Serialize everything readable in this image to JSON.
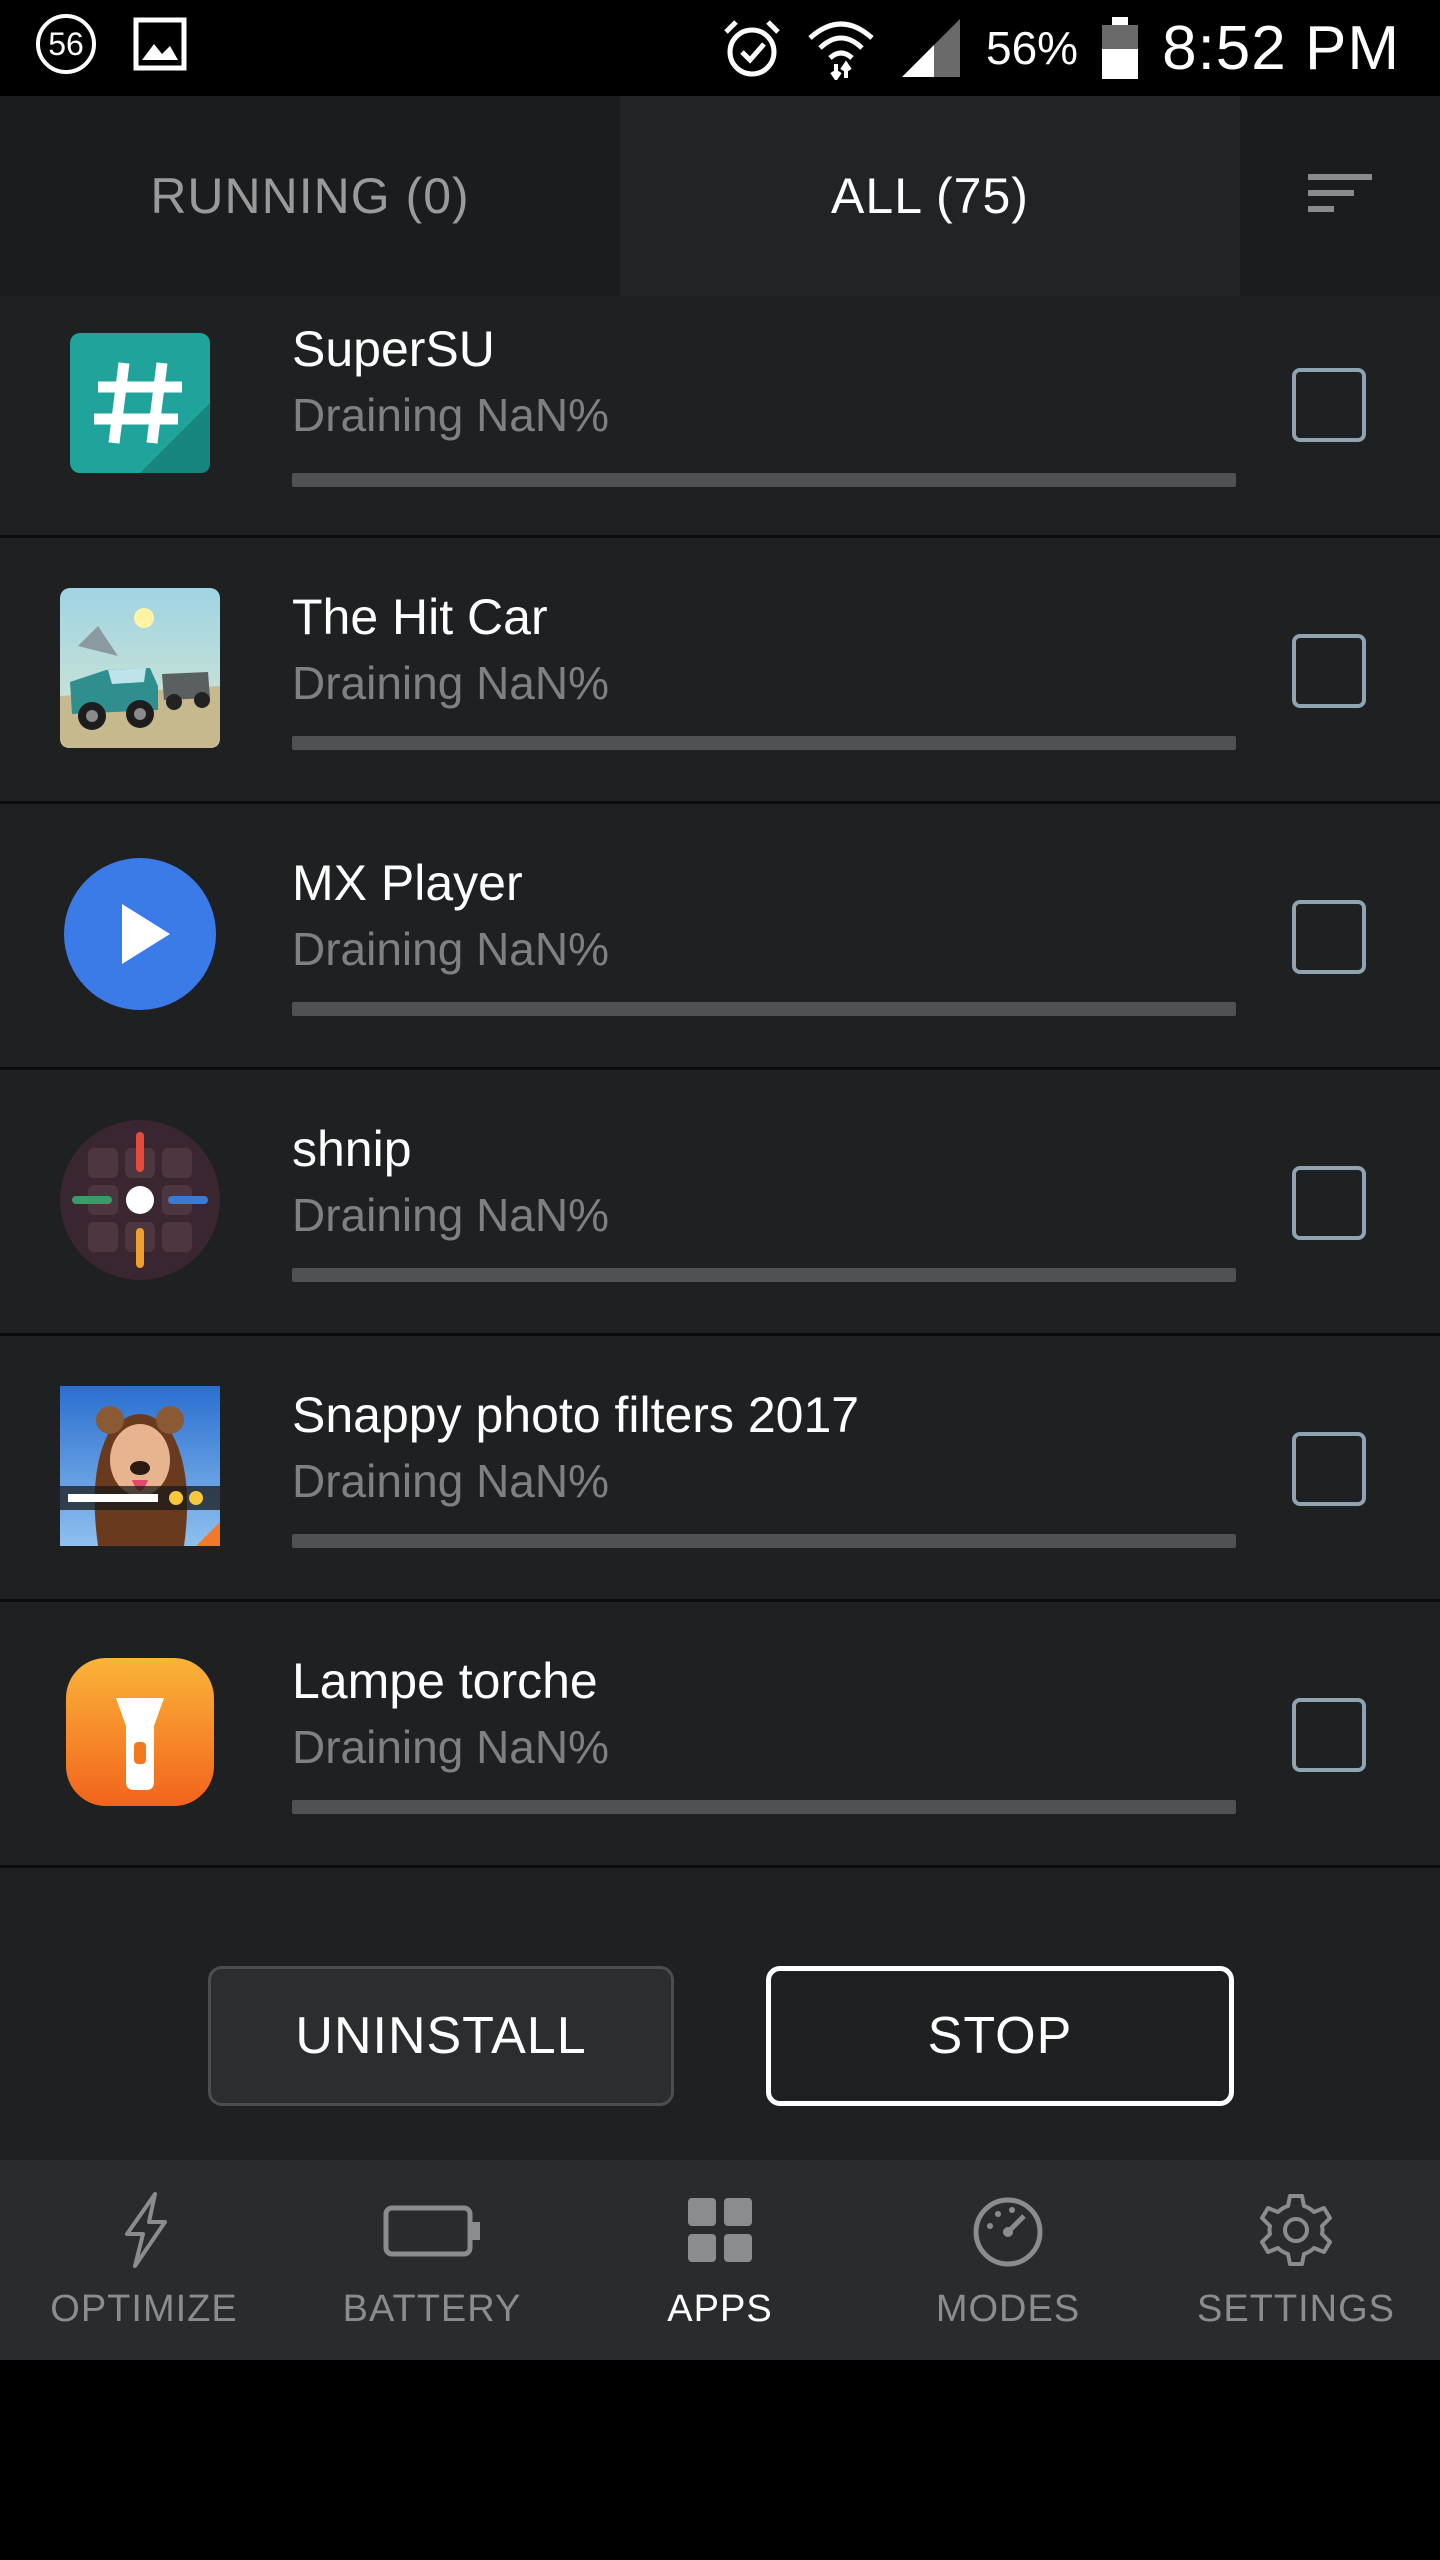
{
  "status_bar": {
    "notification_count": "56",
    "battery_percent": "56%",
    "time": "8:52 PM"
  },
  "tabs": {
    "running": "RUNNING (0)",
    "all": "ALL (75)"
  },
  "apps": [
    {
      "name": "SuperSU",
      "status": "Draining NaN%",
      "drain": 0,
      "icon": "supersu-icon",
      "checked": false
    },
    {
      "name": "The Hit Car",
      "status": "Draining NaN%",
      "drain": 0,
      "icon": "hit-car-icon",
      "checked": false
    },
    {
      "name": "MX Player",
      "status": "Draining NaN%",
      "drain": 0,
      "icon": "mx-player-icon",
      "checked": false
    },
    {
      "name": "shnip",
      "status": "Draining NaN%",
      "drain": 0,
      "icon": "shnip-icon",
      "checked": false
    },
    {
      "name": "Snappy photo filters 2017",
      "status": "Draining NaN%",
      "drain": 0,
      "icon": "snappy-photo-icon",
      "checked": false
    },
    {
      "name": "Lampe torche",
      "status": "Draining NaN%",
      "drain": 0,
      "icon": "flashlight-icon",
      "checked": false
    }
  ],
  "actions": {
    "uninstall": "UNINSTALL",
    "stop": "STOP"
  },
  "bottom_nav": {
    "optimize": "OPTIMIZE",
    "battery": "BATTERY",
    "apps": "APPS",
    "modes": "MODES",
    "settings": "SETTINGS",
    "active": "apps"
  },
  "colors": {
    "background": "#1f2021",
    "tab_active": "#222324",
    "nav_background": "#2a2b2c",
    "checkbox_border": "#8fa3b0"
  }
}
